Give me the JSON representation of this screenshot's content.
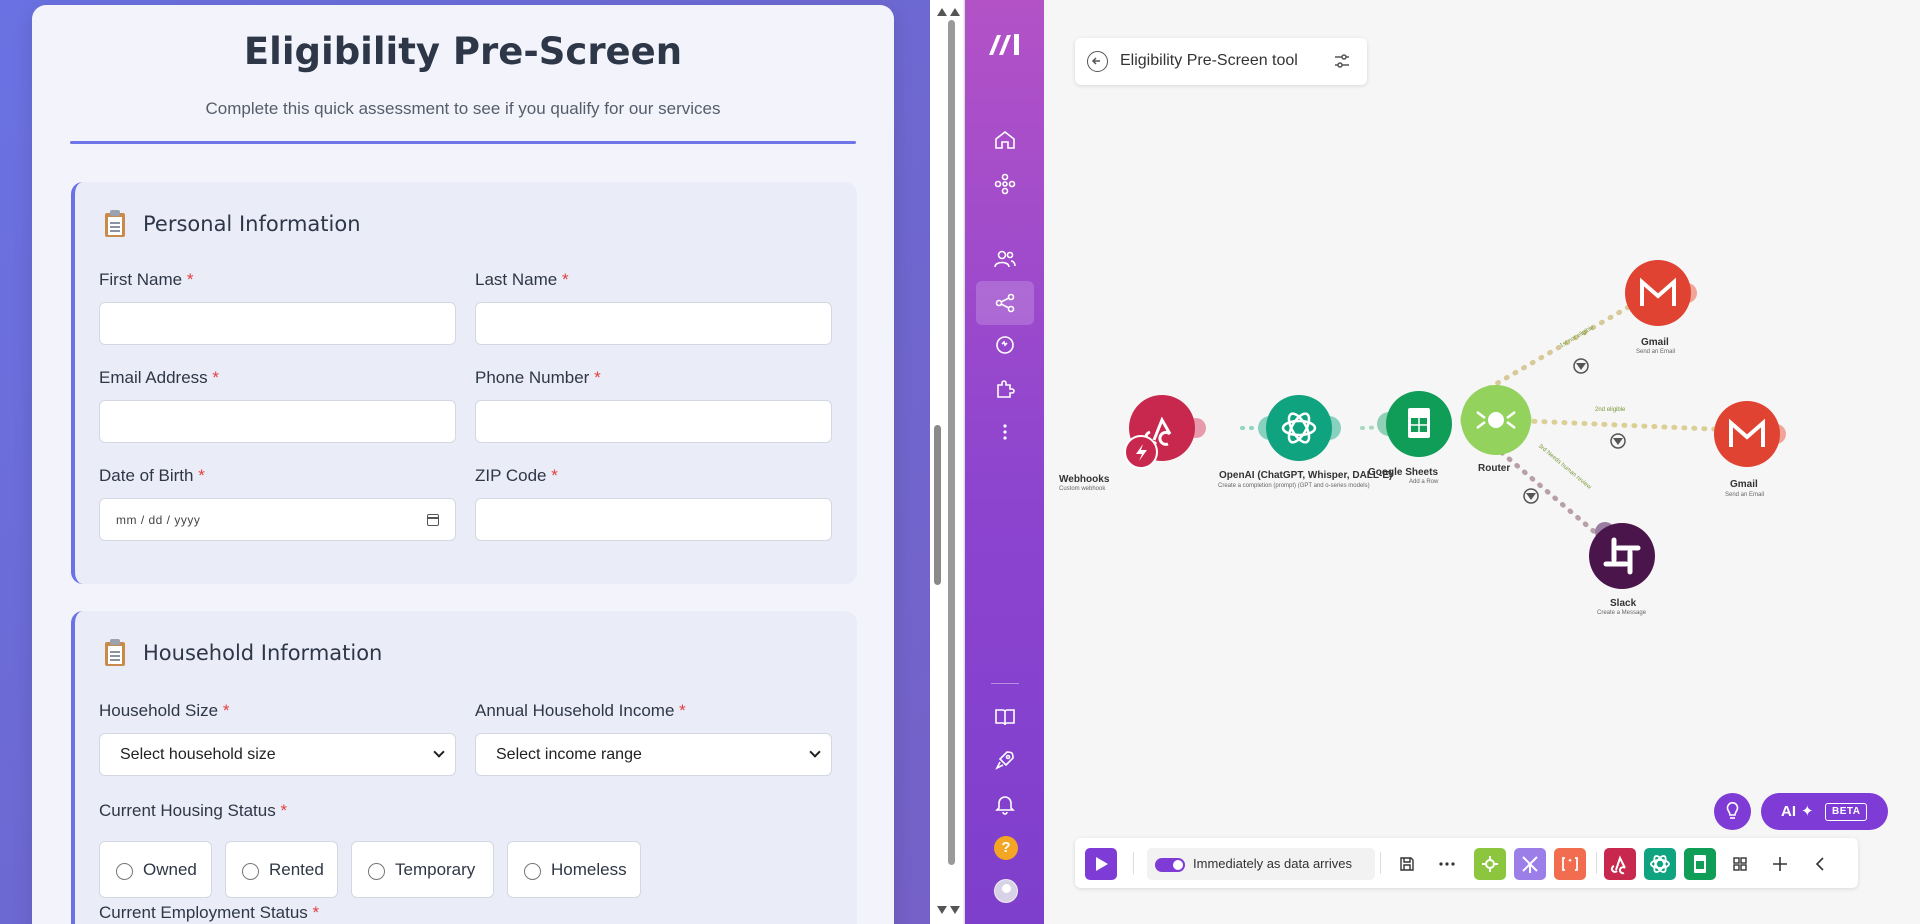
{
  "form": {
    "title": "Eligibility Pre-Screen",
    "subtitle": "Complete this quick assessment to see if you qualify for our services",
    "required_marker": "*",
    "personal": {
      "heading": "Personal Information",
      "first_name_label": "First Name",
      "last_name_label": "Last Name",
      "email_label": "Email Address",
      "phone_label": "Phone Number",
      "dob_label": "Date of Birth",
      "dob_placeholder": "mm / dd / yyyy",
      "zip_label": "ZIP Code"
    },
    "household": {
      "heading": "Household Information",
      "size_label": "Household Size",
      "size_selected": "Select household size",
      "income_label": "Annual Household Income",
      "income_selected": "Select income range",
      "housing_label": "Current Housing Status",
      "housing_options": [
        "Owned",
        "Rented",
        "Temporary",
        "Homeless"
      ],
      "employment_label": "Current Employment Status"
    }
  },
  "app": {
    "scenario_title": "Eligibility Pre-Screen tool",
    "schedule_label": "Immediately as data arrives",
    "ai_label": "AI",
    "beta_label": "BETA",
    "help_glyph": "?",
    "colors": {
      "sidebar_top": "#b352c7",
      "sidebar_bottom": "#7e3fcc",
      "accent": "#7f3bd6",
      "webhooks": "#c8284e",
      "openai": "#10a37f",
      "sheets": "#0f9d58",
      "router": "#93d35d",
      "gmail": "#e04332",
      "slack": "#4a154b"
    },
    "modules": [
      {
        "name": "Webhooks",
        "sub": "Custom webhook",
        "icon": "webhook-icon",
        "id": "1"
      },
      {
        "name": "OpenAI (ChatGPT, Whisper, DALL-E)",
        "sub": "Create a completion (prompt) (GPT and o-series models)",
        "icon": "openai-icon",
        "id": "4"
      },
      {
        "name": "Google Sheets",
        "sub": "Add a Row",
        "icon": "google-sheets-icon",
        "id": "10"
      },
      {
        "name": "Router",
        "sub": "",
        "icon": "router-icon",
        "id": "3"
      },
      {
        "name": "Gmail",
        "sub": "Send an Email",
        "icon": "gmail-icon",
        "id": "14"
      },
      {
        "name": "Gmail",
        "sub": "Send an Email",
        "icon": "gmail-icon",
        "id": "13"
      },
      {
        "name": "Slack",
        "sub": "Create a Message",
        "icon": "slack-icon",
        "id": "15"
      }
    ],
    "routes": [
      {
        "label": "1st",
        "filter": "not eligible"
      },
      {
        "label": "2nd",
        "filter": "eligible"
      },
      {
        "label": "3rd",
        "filter": "Needs human review"
      }
    ]
  }
}
